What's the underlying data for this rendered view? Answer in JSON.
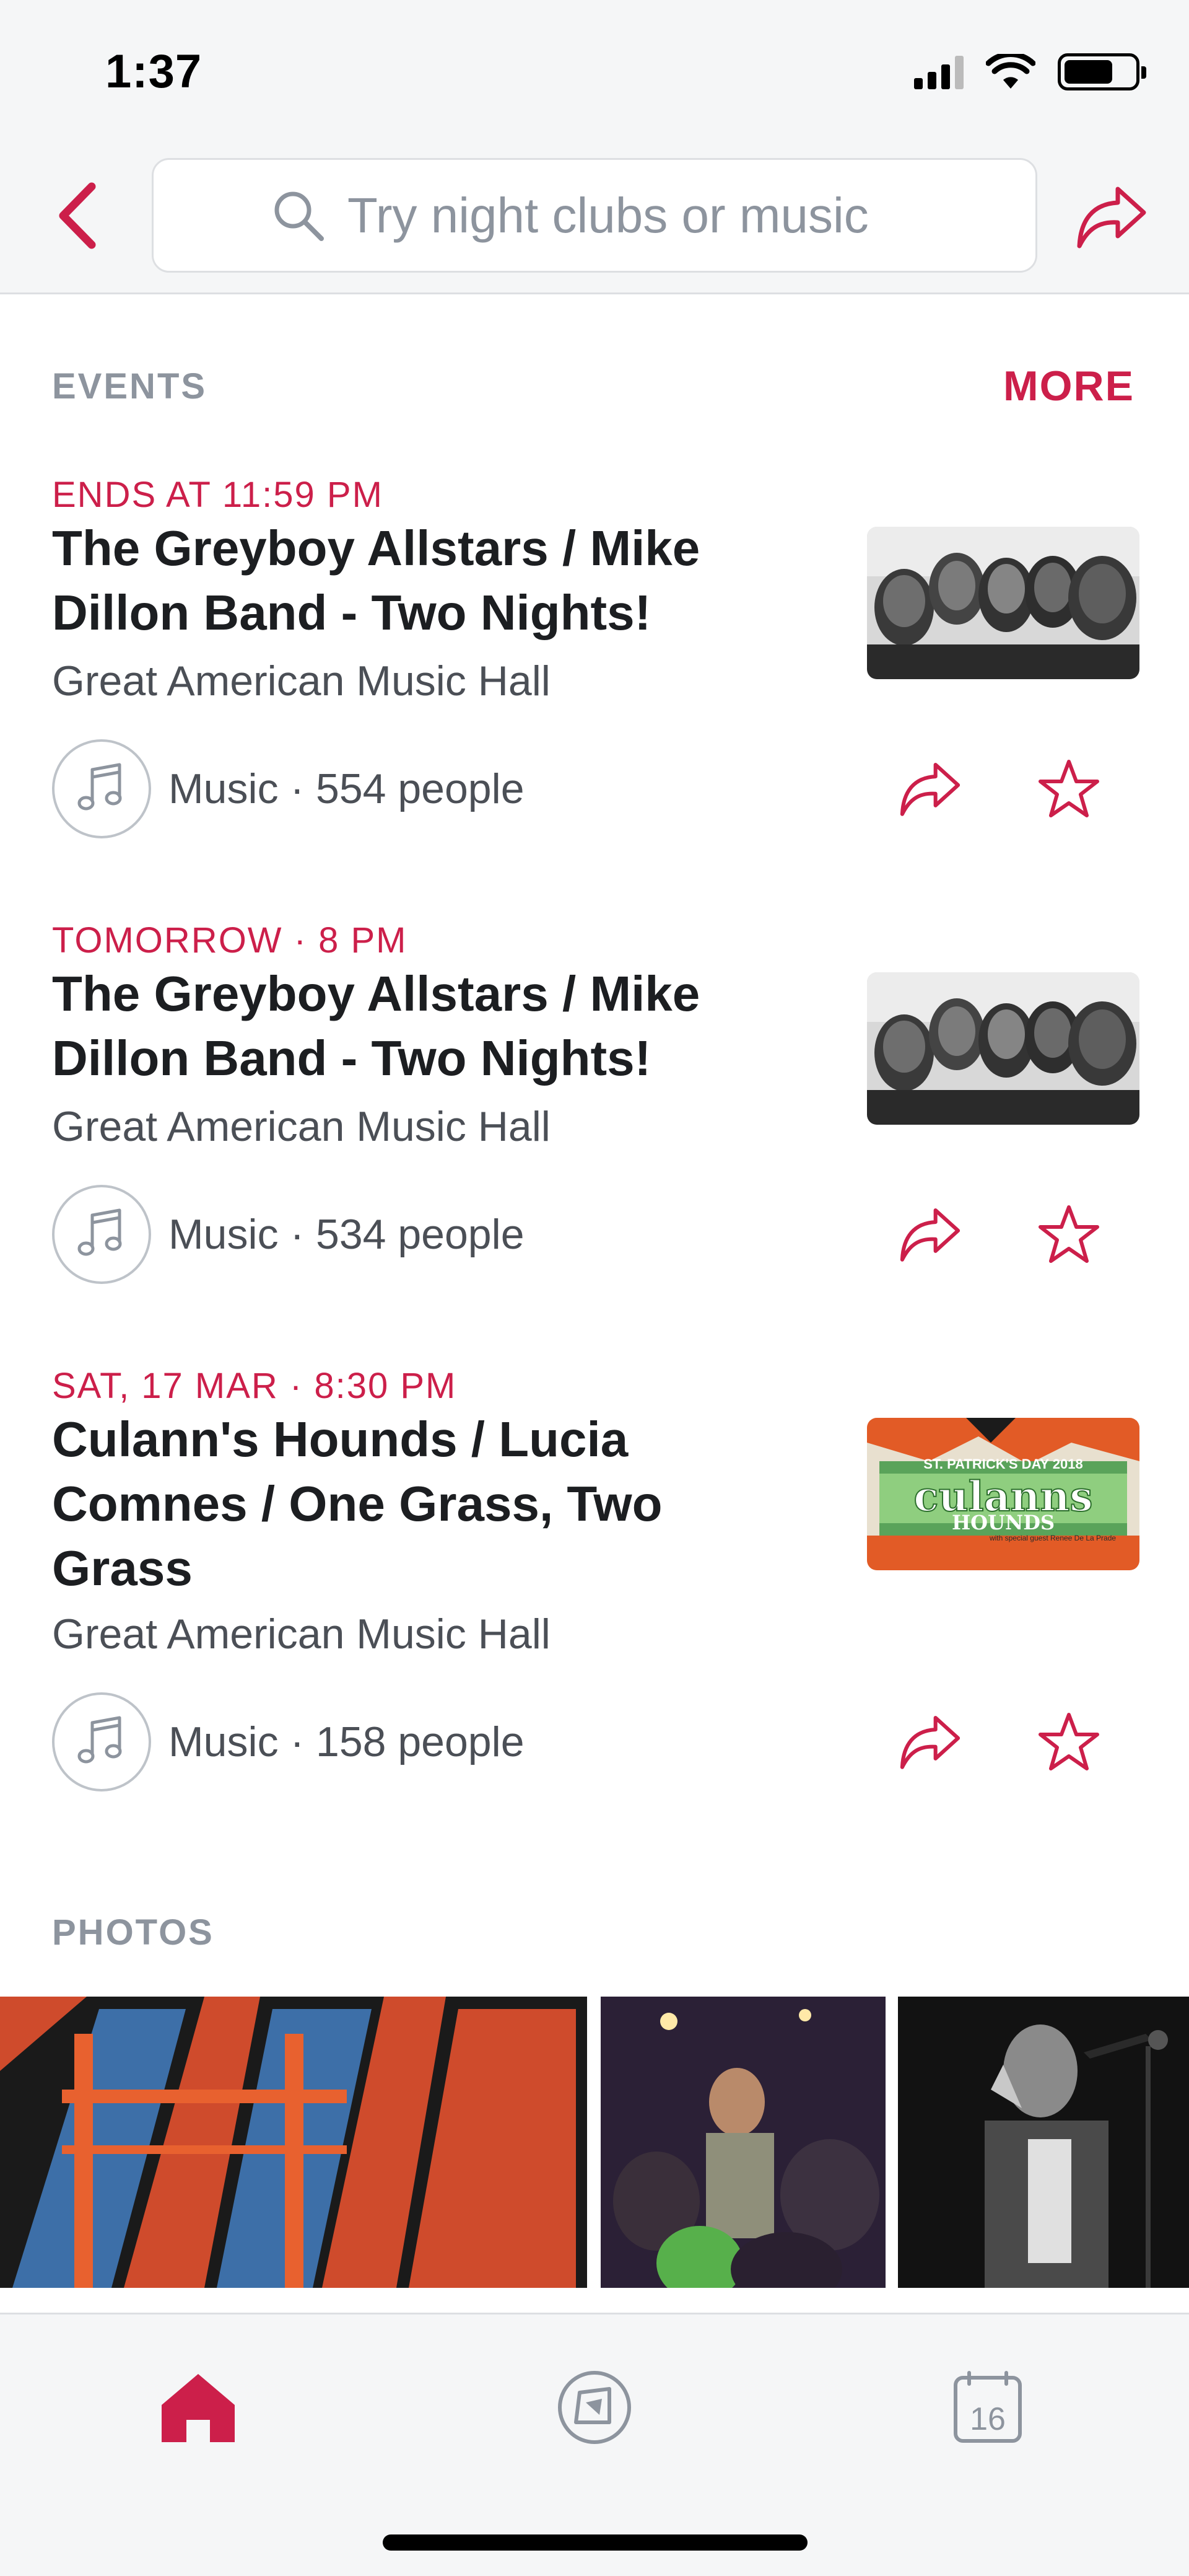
{
  "status_bar": {
    "time": "1:37"
  },
  "search": {
    "placeholder": "Try night clubs or music"
  },
  "events_section": {
    "title": "EVENTS",
    "more_label": "MORE"
  },
  "events": [
    {
      "date": "ENDS AT 11:59 PM",
      "title": "The Greyboy Allstars / Mike Dillon Band - Two Nights!",
      "venue": "Great American Music Hall",
      "meta": "Music · 554 people"
    },
    {
      "date": "TOMORROW · 8 PM",
      "title": "The Greyboy Allstars / Mike Dillon Band - Two Nights!",
      "venue": "Great American Music Hall",
      "meta": "Music · 534 people"
    },
    {
      "date": "SAT, 17 MAR · 8:30 PM",
      "title": "Culann's Hounds / Lucia Comnes / One Grass, Two Grass",
      "venue": "Great American Music Hall",
      "meta": "Music · 158 people"
    }
  ],
  "poster_text": {
    "header": "ST. PATRICK'S DAY 2018",
    "name": "culanns",
    "sub": "HOUNDS",
    "guest": "with special guest Renee De La Prade"
  },
  "photos_section": {
    "title": "PHOTOS"
  },
  "tabbar": {
    "calendar_day": "16"
  },
  "colors": {
    "accent": "#cc1f4a",
    "muted": "#8d949e",
    "background": "#f5f6f7"
  }
}
